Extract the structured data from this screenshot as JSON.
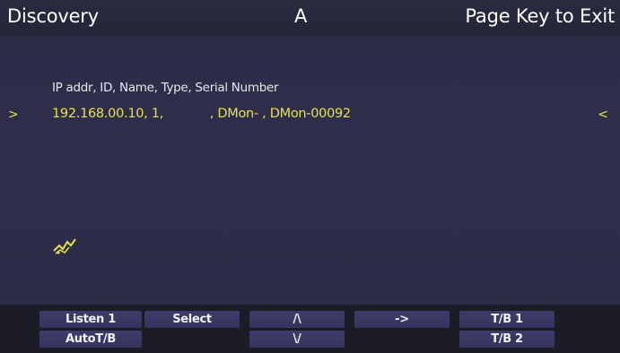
{
  "title_bar": {
    "left": "Discovery",
    "center": "A",
    "right": "Page Key to Exit"
  },
  "list": {
    "header": "IP addr, ID, Name, Type, Serial Number",
    "rows": [
      {
        "text": "192.168.00.10, 1,            , DMon- , DMon-00092"
      }
    ],
    "left_marker": ">",
    "right_marker": "<"
  },
  "softkeys": {
    "listen1": "Listen 1",
    "select": "Select",
    "up": "/\\",
    "right_arrow": "->",
    "tb1": "T/B 1",
    "autotb": "AutoT/B",
    "down": "\\/",
    "tb2": "T/B 2"
  },
  "colors": {
    "background": "#2d2d48",
    "highlight_text": "#e6e055",
    "softkey_bg": "#3a3a66"
  }
}
